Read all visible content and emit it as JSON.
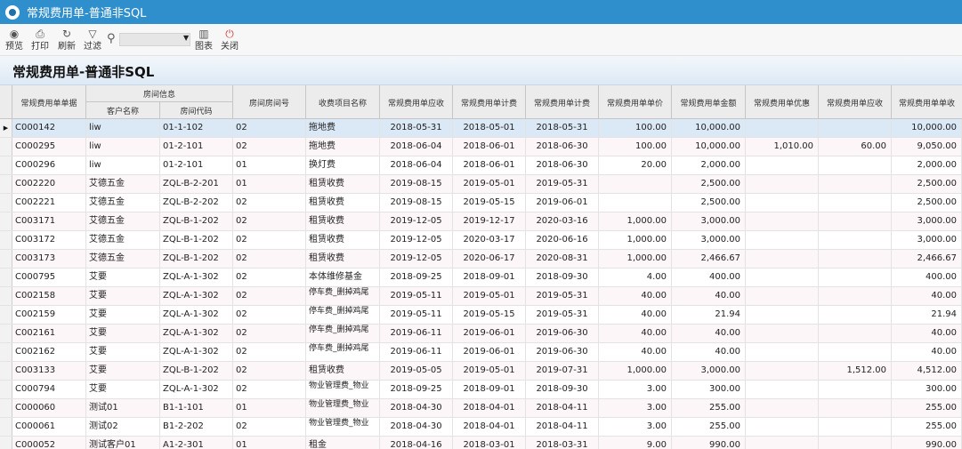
{
  "window": {
    "title": "常规费用单-普通非SQL"
  },
  "toolbar": {
    "preview": "预览",
    "print": "打印",
    "refresh": "刷新",
    "filter": "过滤",
    "chart": "图表",
    "close": "关闭",
    "search_value": ""
  },
  "page": {
    "heading": "常规费用单-普通非SQL"
  },
  "table": {
    "group_header": "房间信息",
    "headers": [
      "常规费用单单据",
      "客户名称",
      "房间代码",
      "房间房间号",
      "收费项目名称",
      "常规费用单应收",
      "常规费用单计费",
      "常规费用单计费",
      "常规费用单单价",
      "常规费用单金额",
      "常规费用单优惠",
      "常规费用单应收",
      "常规费用单单收"
    ],
    "rows": [
      [
        "C000142",
        "liw",
        "01-1-102",
        "02",
        "拖地费",
        "2018-05-31",
        "2018-05-01",
        "2018-05-31",
        "100.00",
        "10,000.00",
        "",
        "",
        "10,000.00"
      ],
      [
        "C000295",
        "liw",
        "01-2-101",
        "02",
        "拖地费",
        "2018-06-04",
        "2018-06-01",
        "2018-06-30",
        "100.00",
        "10,000.00",
        "1,010.00",
        "60.00",
        "9,050.00"
      ],
      [
        "C000296",
        "liw",
        "01-2-101",
        "01",
        "换灯费",
        "2018-06-04",
        "2018-06-01",
        "2018-06-30",
        "20.00",
        "2,000.00",
        "",
        "",
        "2,000.00"
      ],
      [
        "C002220",
        "艾德五金",
        "ZQL-B-2-201",
        "01",
        "租赁收费",
        "2019-08-15",
        "2019-05-01",
        "2019-05-31",
        "",
        "2,500.00",
        "",
        "",
        "2,500.00"
      ],
      [
        "C002221",
        "艾德五金",
        "ZQL-B-2-202",
        "02",
        "租赁收费",
        "2019-08-15",
        "2019-05-15",
        "2019-06-01",
        "",
        "2,500.00",
        "",
        "",
        "2,500.00"
      ],
      [
        "C003171",
        "艾德五金",
        "ZQL-B-1-202",
        "02",
        "租赁收费",
        "2019-12-05",
        "2019-12-17",
        "2020-03-16",
        "1,000.00",
        "3,000.00",
        "",
        "",
        "3,000.00"
      ],
      [
        "C003172",
        "艾德五金",
        "ZQL-B-1-202",
        "02",
        "租赁收费",
        "2019-12-05",
        "2020-03-17",
        "2020-06-16",
        "1,000.00",
        "3,000.00",
        "",
        "",
        "3,000.00"
      ],
      [
        "C003173",
        "艾德五金",
        "ZQL-B-1-202",
        "02",
        "租赁收费",
        "2019-12-05",
        "2020-06-17",
        "2020-08-31",
        "1,000.00",
        "2,466.67",
        "",
        "",
        "2,466.67"
      ],
      [
        "C000795",
        "艾要",
        "ZQL-A-1-302",
        "02",
        "本体维修基金",
        "2018-09-25",
        "2018-09-01",
        "2018-09-30",
        "4.00",
        "400.00",
        "",
        "",
        "400.00"
      ],
      [
        "C002158",
        "艾要",
        "ZQL-A-1-302",
        "02",
        "停车费_删掉鸡尾",
        "2019-05-11",
        "2019-05-01",
        "2019-05-31",
        "40.00",
        "40.00",
        "",
        "",
        "40.00"
      ],
      [
        "C002159",
        "艾要",
        "ZQL-A-1-302",
        "02",
        "停车费_删掉鸡尾",
        "2019-05-11",
        "2019-05-15",
        "2019-05-31",
        "40.00",
        "21.94",
        "",
        "",
        "21.94"
      ],
      [
        "C002161",
        "艾要",
        "ZQL-A-1-302",
        "02",
        "停车费_删掉鸡尾",
        "2019-06-11",
        "2019-06-01",
        "2019-06-30",
        "40.00",
        "40.00",
        "",
        "",
        "40.00"
      ],
      [
        "C002162",
        "艾要",
        "ZQL-A-1-302",
        "02",
        "停车费_删掉鸡尾",
        "2019-06-11",
        "2019-06-01",
        "2019-06-30",
        "40.00",
        "40.00",
        "",
        "",
        "40.00"
      ],
      [
        "C003133",
        "艾要",
        "ZQL-B-1-202",
        "02",
        "租赁收费",
        "2019-05-05",
        "2019-05-01",
        "2019-07-31",
        "1,000.00",
        "3,000.00",
        "",
        "1,512.00",
        "4,512.00"
      ],
      [
        "C000794",
        "艾要",
        "ZQL-A-1-302",
        "02",
        "物业管理费_物业",
        "2018-09-25",
        "2018-09-01",
        "2018-09-30",
        "3.00",
        "300.00",
        "",
        "",
        "300.00"
      ],
      [
        "C000060",
        "测试01",
        "B1-1-101",
        "01",
        "物业管理费_物业",
        "2018-04-30",
        "2018-04-01",
        "2018-04-11",
        "3.00",
        "255.00",
        "",
        "",
        "255.00"
      ],
      [
        "C000061",
        "测试02",
        "B1-2-202",
        "02",
        "物业管理费_物业",
        "2018-04-30",
        "2018-04-01",
        "2018-04-11",
        "3.00",
        "255.00",
        "",
        "",
        "255.00"
      ],
      [
        "C000052",
        "测试客户01",
        "A1-2-301",
        "01",
        "租金",
        "2018-04-16",
        "2018-03-01",
        "2018-03-31",
        "9.00",
        "990.00",
        "",
        "",
        "990.00"
      ]
    ]
  }
}
